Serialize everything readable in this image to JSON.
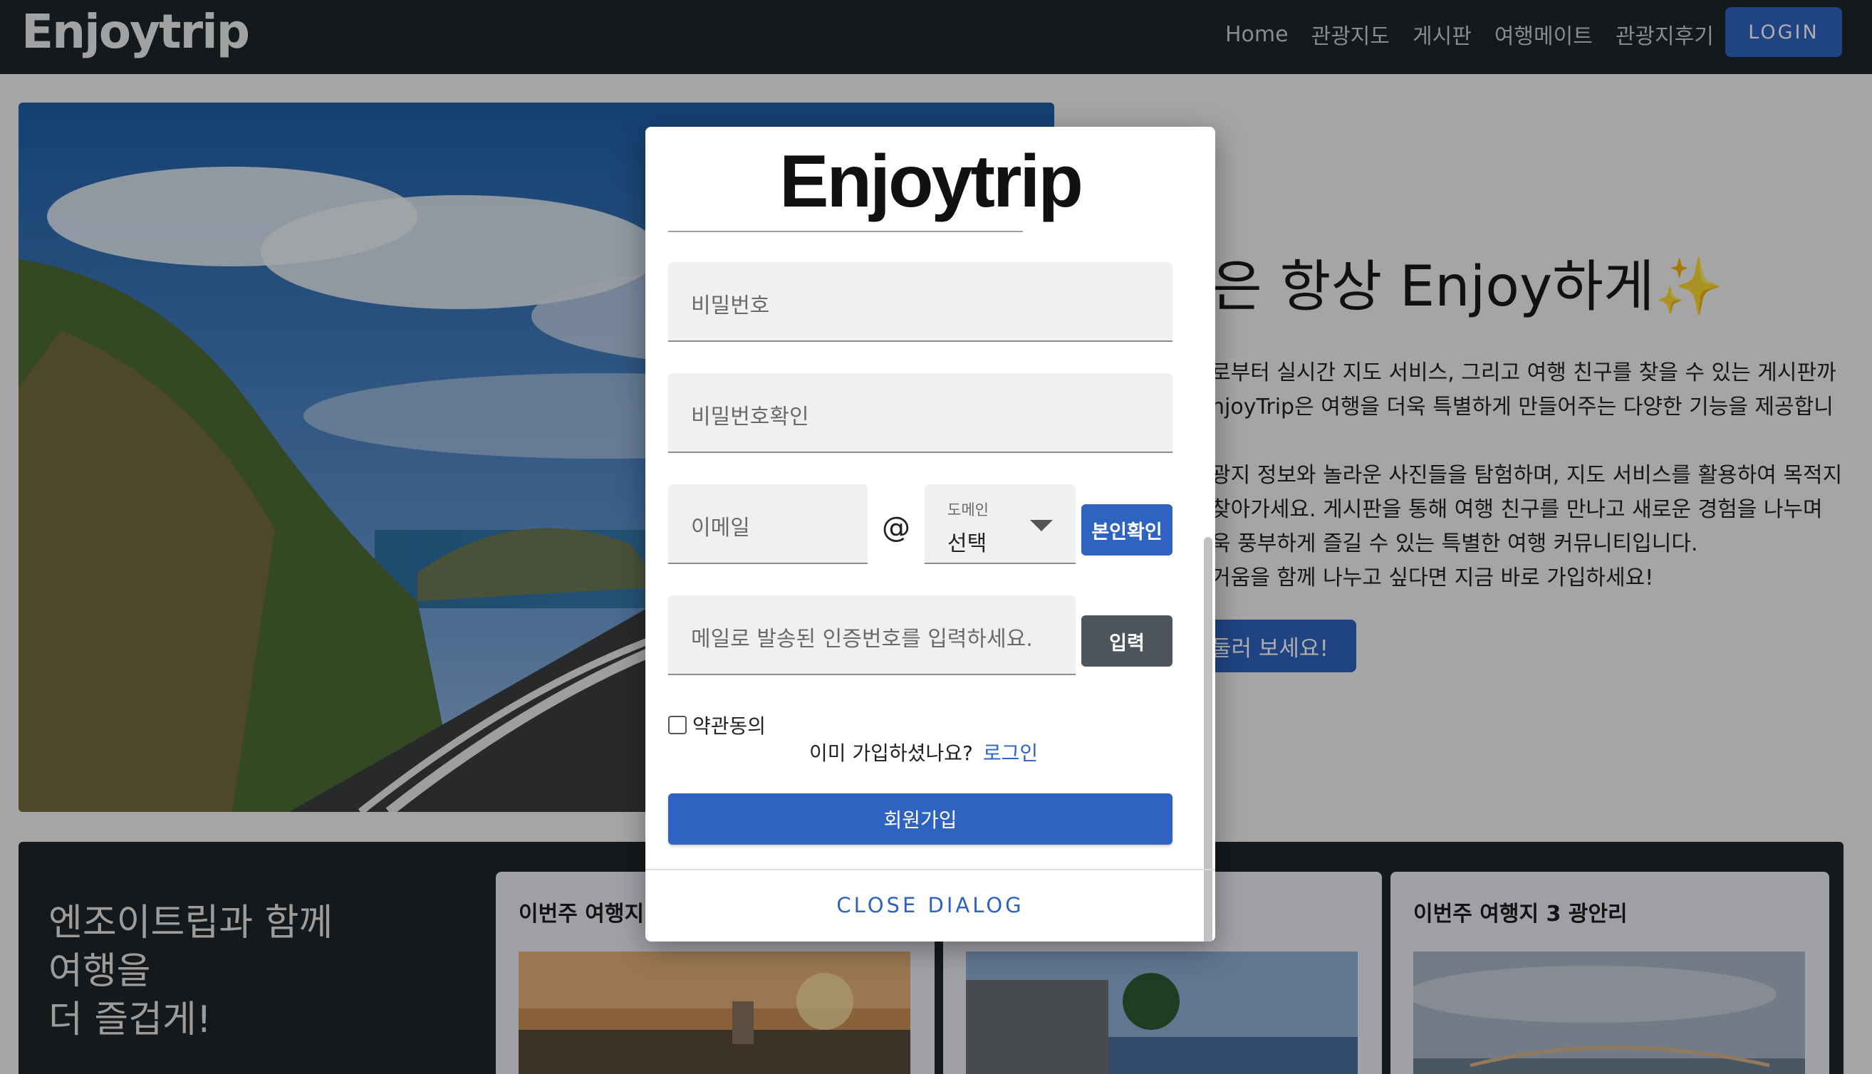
{
  "navbar": {
    "brand": "Enjoytrip",
    "links": [
      "Home",
      "관광지도",
      "게시판",
      "여행메이트",
      "관광지후기"
    ],
    "login_label": "LOGIN"
  },
  "hero": {
    "title": "은 항상 Enjoy하게✨",
    "lines": [
      "로부터 실시간 지도 서비스, 그리고 여행 친구를 찾을 수 있는 게시판까",
      "njoyTrip은 여행을 더욱 특별하게 만들어주는 다양한 기능을 제공합니",
      "광지 정보와 놀라운 사진들을 탐험하며, 지도 서비스를 활용하여 목적지",
      "찾아가세요. 게시판을 통해 여행 친구를 만나고 새로운 경험을 나누며",
      "욱 풍부하게 즐길 수 있는 특별한 여행 커뮤니티입니다.",
      "거움을 함께 나누고 싶다면 지금 바로 가입하세요!"
    ],
    "cta_label": "둘러 보세요!"
  },
  "bottom": {
    "title_lines": [
      "엔조이트립과 함께",
      "여행을",
      "더 즐겁게!"
    ],
    "cards": [
      {
        "title": "이번주 여행지"
      },
      {
        "title": ""
      },
      {
        "title": "이번주 여행지 3 광안리"
      }
    ]
  },
  "dialog": {
    "logo": "Enjoytrip",
    "password_placeholder": "비밀번호",
    "password_confirm_placeholder": "비밀번호확인",
    "email_placeholder": "이메일",
    "at_symbol": "@",
    "domain_label": "도메인",
    "domain_value": "선택",
    "verify_label": "본인확인",
    "code_placeholder": "메일로 발송된 인증번호를 입력하세요.",
    "code_button_label": "입력",
    "terms_label": "약관동의",
    "already_text": "이미 가입하셨나요?",
    "login_link": "로그인",
    "signup_label": "회원가입",
    "close_label": "CLOSE DIALOG"
  }
}
